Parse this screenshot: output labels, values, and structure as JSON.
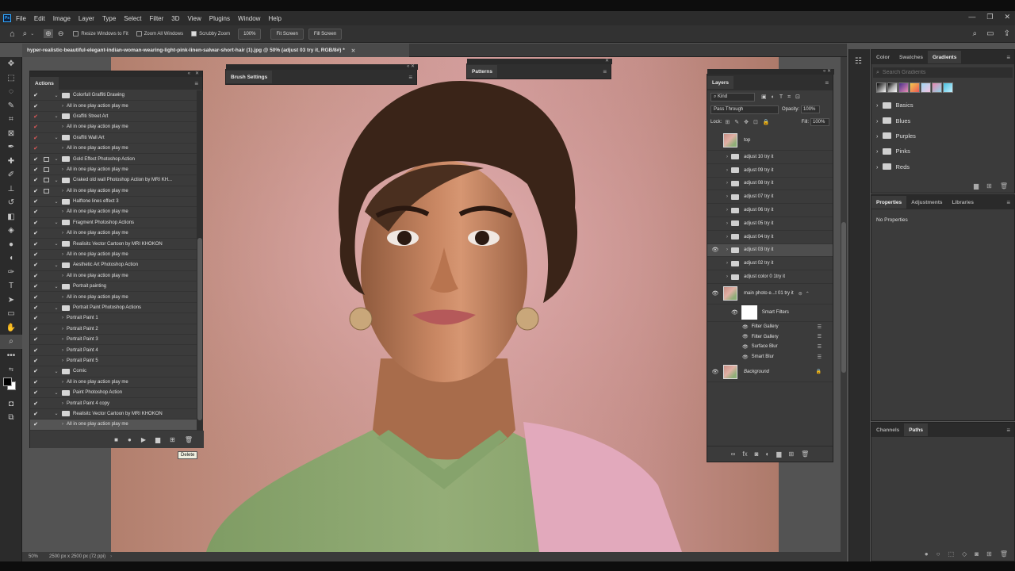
{
  "menu": [
    "File",
    "Edit",
    "Image",
    "Layer",
    "Type",
    "Select",
    "Filter",
    "3D",
    "View",
    "Plugins",
    "Window",
    "Help"
  ],
  "options": {
    "resize_windows": "Resize Windows to Fit",
    "zoom_all": "Zoom All Windows",
    "scrubby": "Scrubby Zoom",
    "zoom_value": "100%",
    "fit_screen": "Fit Screen",
    "fill_screen": "Fill Screen"
  },
  "document": {
    "tab_title": "hyper-realistic-beautiful-elegant-indian-woman-wearing-light-pink-linen-salwar-short-hair (1).jpg @ 50% (adjust 03 try it, RGB/8#) *",
    "zoom": "50%",
    "size": "2500 px x 2500 px (72 ppi)"
  },
  "actions": {
    "title": "Actions",
    "rows": [
      {
        "label": "Colorfull Graffiti Drawing",
        "set": true,
        "red": false,
        "dlg": false
      },
      {
        "label": "All in one play action play me",
        "set": false,
        "red": false,
        "dlg": false
      },
      {
        "label": "Graffiti Street Art",
        "set": true,
        "red": true,
        "dlg": false
      },
      {
        "label": "All in one play action play me",
        "set": false,
        "red": true,
        "dlg": false
      },
      {
        "label": "Graffiti Wall Art",
        "set": true,
        "red": true,
        "dlg": false
      },
      {
        "label": "All in one play action play me",
        "set": false,
        "red": true,
        "dlg": false
      },
      {
        "label": "Gold Effect Photoshop Action",
        "set": true,
        "red": false,
        "dlg": true
      },
      {
        "label": "All in one play action play me",
        "set": false,
        "red": false,
        "dlg": true
      },
      {
        "label": "Craked old wall Photoshop Action by MRI KH...",
        "set": true,
        "red": false,
        "dlg": true
      },
      {
        "label": "All in one play action play me",
        "set": false,
        "red": false,
        "dlg": true
      },
      {
        "label": "Halftone lines effect 3",
        "set": true,
        "red": false,
        "dlg": false
      },
      {
        "label": "All in one play action play me",
        "set": false,
        "red": false,
        "dlg": false
      },
      {
        "label": "Fragment Photoshop Actions",
        "set": true,
        "red": false,
        "dlg": false
      },
      {
        "label": "All in one play action play me",
        "set": false,
        "red": false,
        "dlg": false
      },
      {
        "label": "Realisitc Vector Cartoon by MRI KHOKON",
        "set": true,
        "red": false,
        "dlg": false
      },
      {
        "label": "All in one play action play me",
        "set": false,
        "red": false,
        "dlg": false
      },
      {
        "label": "Aesthetic Art Photoshop Action",
        "set": true,
        "red": false,
        "dlg": false
      },
      {
        "label": "All in one play action play me",
        "set": false,
        "red": false,
        "dlg": false
      },
      {
        "label": "Portrait painting",
        "set": true,
        "red": false,
        "dlg": false
      },
      {
        "label": "All in one play action play me",
        "set": false,
        "red": false,
        "dlg": false
      },
      {
        "label": "Portrait Paint Photoshop Actions",
        "set": true,
        "red": false,
        "dlg": false
      },
      {
        "label": "Portrait Paint 1",
        "set": false,
        "red": false,
        "dlg": false
      },
      {
        "label": "Portrait Paint 2",
        "set": false,
        "red": false,
        "dlg": false
      },
      {
        "label": "Portrait Paint 3",
        "set": false,
        "red": false,
        "dlg": false
      },
      {
        "label": "Portrait Paint 4",
        "set": false,
        "red": false,
        "dlg": false
      },
      {
        "label": "Portrait Paint 5",
        "set": false,
        "red": false,
        "dlg": false
      },
      {
        "label": "Comic",
        "set": true,
        "red": false,
        "dlg": false
      },
      {
        "label": "All in one play action play me",
        "set": false,
        "red": false,
        "dlg": false
      },
      {
        "label": "Paint Photoshop Action",
        "set": true,
        "red": false,
        "dlg": false
      },
      {
        "label": "Portrait Paint 4 copy",
        "set": false,
        "red": false,
        "dlg": false
      },
      {
        "label": "Realisitc Vector Cartoon by MRI KHOKON",
        "set": true,
        "red": false,
        "dlg": false
      },
      {
        "label": "All in one play action play me",
        "set": false,
        "red": false,
        "dlg": false
      }
    ],
    "tooltip": "Delete"
  },
  "brush_settings": {
    "title": "Brush Settings"
  },
  "patterns": {
    "title": "Patterns"
  },
  "layers": {
    "title": "Layers",
    "kind": "Kind",
    "blend": "Pass Through",
    "opacity_label": "Opacity:",
    "opacity": "100%",
    "lock_label": "Lock:",
    "fill_label": "Fill:",
    "fill": "100%",
    "rows": [
      {
        "name": "top",
        "type": "thumb",
        "eye": false
      },
      {
        "name": "adjust 10 try it",
        "type": "group",
        "eye": false
      },
      {
        "name": "adjust 09 try it",
        "type": "group",
        "eye": false
      },
      {
        "name": "adjust 08 try it",
        "type": "group",
        "eye": false
      },
      {
        "name": "adjust 07 try it",
        "type": "group",
        "eye": false
      },
      {
        "name": "adjust 06 try it",
        "type": "group",
        "eye": false
      },
      {
        "name": "adjust 05 try it",
        "type": "group",
        "eye": false
      },
      {
        "name": "adjust 04 try it",
        "type": "group",
        "eye": false
      },
      {
        "name": "adjust 03 try it",
        "type": "group",
        "eye": true,
        "selected": true
      },
      {
        "name": "adjust 02 try it",
        "type": "group",
        "eye": false
      },
      {
        "name": "adjust color 0 1try it",
        "type": "group",
        "eye": false
      }
    ],
    "main_layer": "main photo e...t 01 try it",
    "smart_filters": "Smart Filters",
    "filters": [
      "Filter Gallery",
      "Filter Gallery",
      "Surface Blur",
      "Smart Blur"
    ],
    "background": "Background"
  },
  "gradients": {
    "tabs": [
      "Color",
      "Swatches",
      "Gradients"
    ],
    "search_placeholder": "Search Gradients",
    "folders": [
      "Basics",
      "Blues",
      "Purples",
      "Pinks",
      "Reds"
    ]
  },
  "properties": {
    "tabs": [
      "Properties",
      "Adjustments",
      "Libraries"
    ],
    "empty": "No Properties"
  },
  "paths": {
    "tabs": [
      "Channels",
      "Paths"
    ]
  }
}
